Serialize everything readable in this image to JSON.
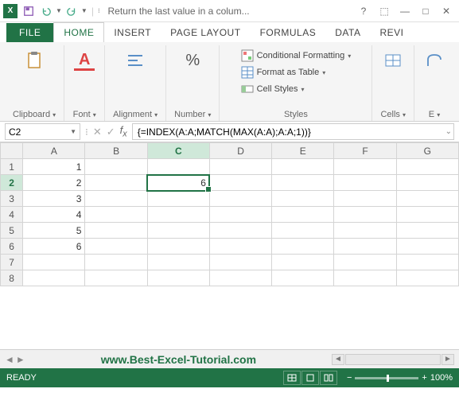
{
  "title": "Return the last value in a colum...",
  "qat": {
    "save": "Save",
    "undo": "Undo",
    "redo": "Redo"
  },
  "win": {
    "help": "?",
    "full": "⬚",
    "min": "—",
    "max": "□",
    "close": "✕"
  },
  "tabs": {
    "file": "FILE",
    "home": "HOME",
    "insert": "INSERT",
    "page_layout": "PAGE LAYOUT",
    "formulas": "FORMULAS",
    "data": "DATA",
    "review": "REVI"
  },
  "ribbon": {
    "clipboard": {
      "label": "Clipboard"
    },
    "font": {
      "label": "Font",
      "btn": "A"
    },
    "alignment": {
      "label": "Alignment"
    },
    "number": {
      "label": "Number",
      "btn": "%"
    },
    "styles": {
      "label": "Styles",
      "cond": "Conditional Formatting",
      "table": "Format as Table",
      "cell": "Cell Styles"
    },
    "cells": {
      "label": "Cells"
    },
    "editing": {
      "label": "E"
    }
  },
  "namebox": "C2",
  "formula": "{=INDEX(A:A;MATCH(MAX(A:A);A:A;1))}",
  "columns": [
    "A",
    "B",
    "C",
    "D",
    "E",
    "F",
    "G"
  ],
  "rows": [
    "1",
    "2",
    "3",
    "4",
    "5",
    "6",
    "7",
    "8"
  ],
  "cells": {
    "A1": "1",
    "A2": "2",
    "A3": "3",
    "A4": "4",
    "A5": "5",
    "A6": "6",
    "C2": "6"
  },
  "active": {
    "row": "2",
    "col": "C"
  },
  "sheet_link": "www.Best-Excel-Tutorial.com",
  "status": {
    "ready": "READY",
    "zoom": "100%"
  }
}
